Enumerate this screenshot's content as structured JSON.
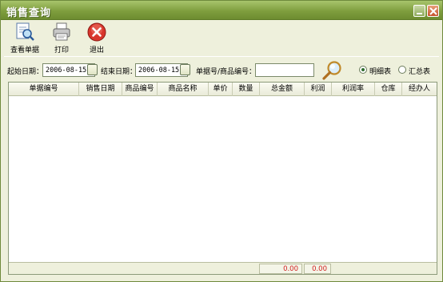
{
  "window": {
    "title": "销售查询"
  },
  "toolbar": {
    "view_label": "查看单据",
    "print_label": "打印",
    "exit_label": "退出"
  },
  "filter": {
    "start_label": "起始日期：",
    "start_value": "2006-08-15",
    "end_label": "结束日期：",
    "end_value": "2006-08-15",
    "code_label": "单据号/商品编号：",
    "code_value": "",
    "radio_detail_label": "明细表",
    "radio_summary_label": "汇总表",
    "selected_mode": "明细表"
  },
  "grid": {
    "columns": [
      "单据编号",
      "销售日期",
      "商品编号",
      "商品名称",
      "单价",
      "数量",
      "总金额",
      "利润",
      "利润率",
      "仓库",
      "经办人"
    ],
    "rows": [],
    "totals": {
      "amount": "0.00",
      "profit": "0.00"
    }
  },
  "colors": {
    "title_bar": "#7f9e3e",
    "window_bg": "#eef0dc",
    "total_text": "#d02020"
  }
}
